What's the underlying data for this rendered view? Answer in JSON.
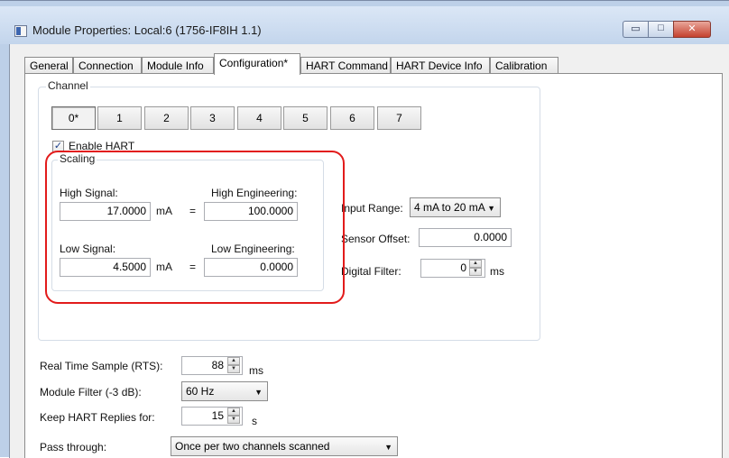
{
  "window": {
    "title": "Module Properties: Local:6 (1756-IF8IH 1.1)",
    "buttons": {
      "minimize": "▭",
      "maximize": "□",
      "close": "✕"
    }
  },
  "tabs": [
    {
      "label": "General"
    },
    {
      "label": "Connection"
    },
    {
      "label": "Module Info"
    },
    {
      "label": "Configuration*"
    },
    {
      "label": "HART Command"
    },
    {
      "label": "HART Device Info"
    },
    {
      "label": "Calibration"
    }
  ],
  "active_tab": "Configuration*",
  "channel": {
    "group_label": "Channel",
    "buttons": [
      "0*",
      "1",
      "2",
      "3",
      "4",
      "5",
      "6",
      "7"
    ],
    "selected": "0*"
  },
  "enable_hart": {
    "label": "Enable HART",
    "checked": true,
    "check_glyph": "✓"
  },
  "scaling": {
    "group_label": "Scaling",
    "high_signal_label": "High Signal:",
    "high_signal_value": "17.0000",
    "high_eng_label": "High Engineering:",
    "high_eng_value": "100.0000",
    "low_signal_label": "Low Signal:",
    "low_signal_value": "4.5000",
    "low_eng_label": "Low Engineering:",
    "low_eng_value": "0.0000",
    "unit": "mA",
    "equals": "="
  },
  "input_range": {
    "label": "Input Range:",
    "value": "4 mA to 20 mA"
  },
  "sensor_offset": {
    "label": "Sensor Offset:",
    "value": "0.0000"
  },
  "digital_filter": {
    "label": "Digital Filter:",
    "value": "0",
    "unit": "ms"
  },
  "rts": {
    "label": "Real Time Sample (RTS):",
    "value": "88",
    "unit": "ms"
  },
  "module_filter": {
    "label": "Module Filter (-3 dB):",
    "value": "60 Hz"
  },
  "keep_hart": {
    "label": "Keep HART Replies for:",
    "value": "15",
    "unit": "s"
  },
  "pass_through": {
    "label": "Pass through:",
    "value": "Once per two channels scanned"
  },
  "highlight_color": "#e21b1b"
}
